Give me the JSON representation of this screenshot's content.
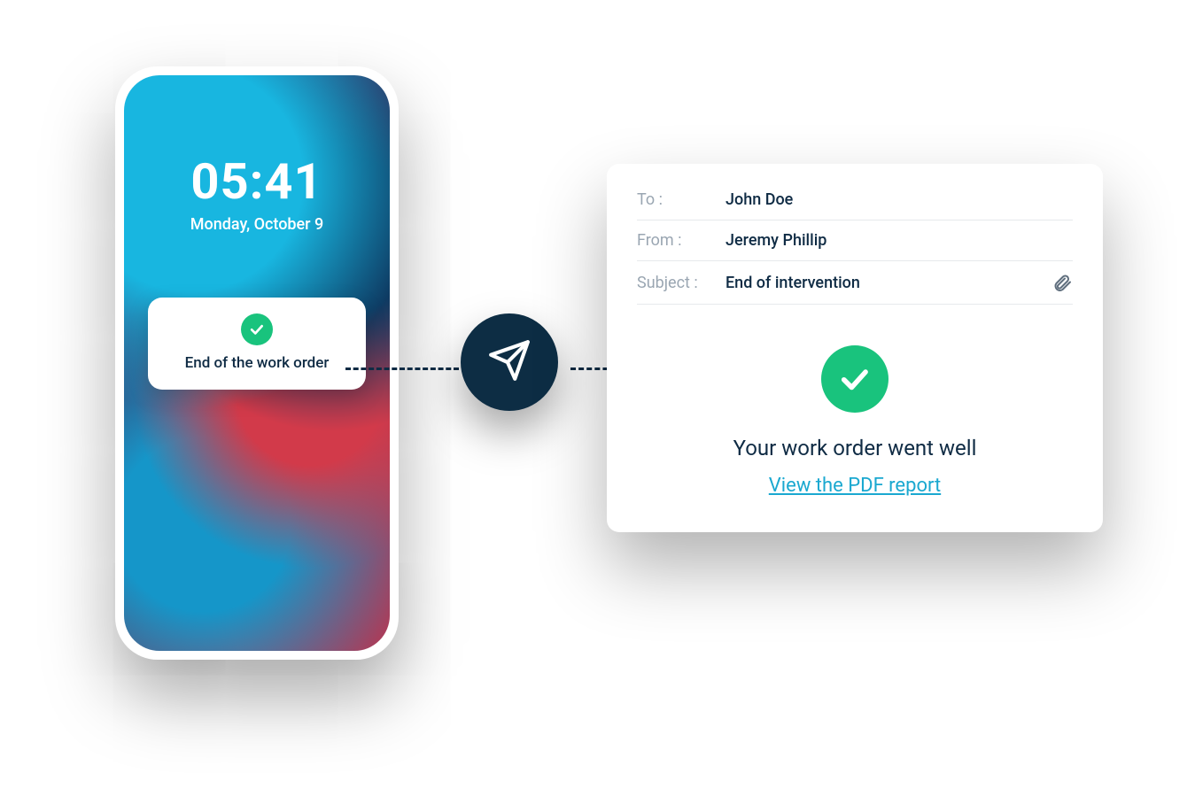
{
  "phone": {
    "time": "05:41",
    "date": "Monday, October 9",
    "notification": {
      "icon": "check-icon",
      "title": "End of the work order"
    }
  },
  "send": {
    "icon": "paper-plane-icon"
  },
  "email": {
    "fields": {
      "to_label": "To :",
      "to_value": "John Doe",
      "from_label": "From :",
      "from_value": "Jeremy Phillip",
      "subject_label": "Subject :",
      "subject_value": "End of intervention"
    },
    "attachment_icon": "paperclip-icon",
    "body": {
      "icon": "check-icon",
      "message": "Your work order went well",
      "link_text": "View the PDF report"
    }
  },
  "colors": {
    "accent_green": "#19c37d",
    "accent_cyan": "#1aa8d0",
    "navy": "#0d2d44",
    "text_dark": "#0f2b44",
    "text_muted": "#9aa6b2"
  }
}
